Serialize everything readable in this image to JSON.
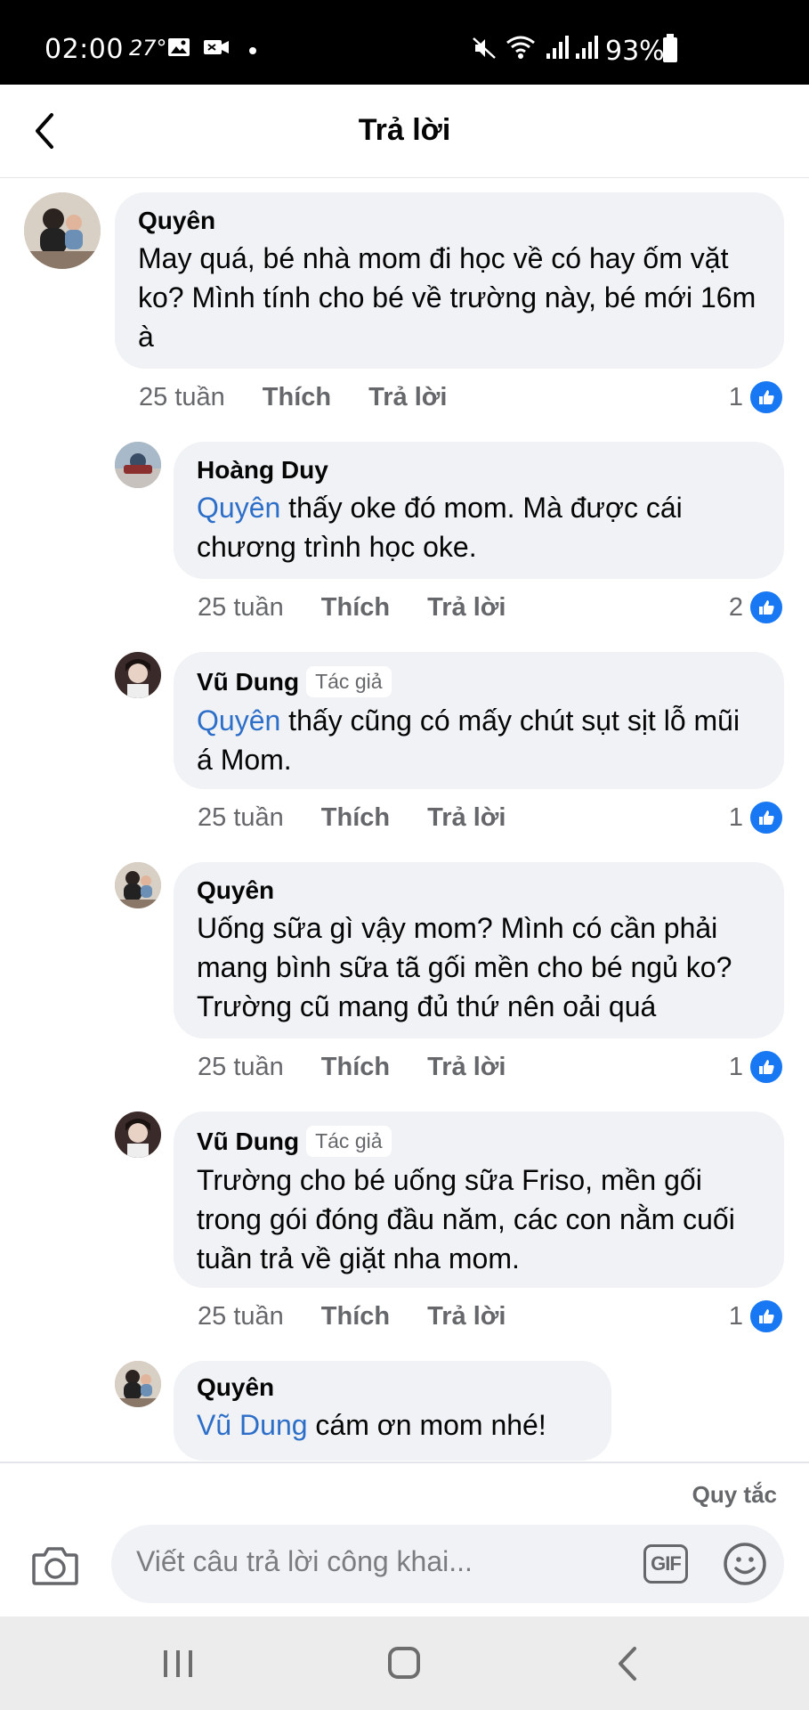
{
  "status_bar": {
    "time": "02:00",
    "temperature": "27°",
    "battery": "93%"
  },
  "header": {
    "title": "Trả lời"
  },
  "comments": [
    {
      "author": "Quyên",
      "badge": "",
      "mention": "",
      "text": "May quá, bé nhà mom đi học về có hay ốm vặt ko? Mình tính cho bé về trường này, bé mới 16m à",
      "time": "25 tuần",
      "like_label": "Thích",
      "reply_label": "Trả lời",
      "likes": "1"
    },
    {
      "author": "Hoàng Duy",
      "badge": "",
      "mention": "Quyên",
      "text": " thấy oke đó mom. Mà được cái chương trình học oke.",
      "time": "25 tuần",
      "like_label": "Thích",
      "reply_label": "Trả lời",
      "likes": "2"
    },
    {
      "author": "Vũ Dung",
      "badge": "Tác giả",
      "mention": "Quyên",
      "text": " thấy cũng có mấy chút sụt sịt lỗ mũi á Mom.",
      "time": "25 tuần",
      "like_label": "Thích",
      "reply_label": "Trả lời",
      "likes": "1"
    },
    {
      "author": "Quyên",
      "badge": "",
      "mention": "",
      "text": "Uống sữa gì vậy mom? Mình có cần phải mang bình sữa tã gối mền cho bé ngủ ko? Trường cũ mang đủ thứ nên oải quá",
      "time": "25 tuần",
      "like_label": "Thích",
      "reply_label": "Trả lời",
      "likes": "1"
    },
    {
      "author": "Vũ Dung",
      "badge": "Tác giả",
      "mention": "",
      "text": "Trường cho bé uống sữa Friso, mền gối trong gói đóng đầu năm, các con nằm cuối tuần trả về giặt nha mom.",
      "time": "25 tuần",
      "like_label": "Thích",
      "reply_label": "Trả lời",
      "likes": "1"
    },
    {
      "author": "Quyên",
      "badge": "",
      "mention": "Vũ Dung",
      "text": " cám ơn mom nhé!",
      "time": "",
      "like_label": "",
      "reply_label": "",
      "likes": ""
    }
  ],
  "footer": {
    "rules_label": "Quy tắc",
    "reply_placeholder": "Viết câu trả lời công khai...",
    "gif_label": "GIF"
  },
  "icons": {
    "back": "chevron-left-icon",
    "like": "thumbs-up-icon",
    "camera": "camera-icon",
    "emoji": "smiley-icon",
    "accent_color": "#1877f2",
    "mention_color": "#2d6fc8"
  }
}
